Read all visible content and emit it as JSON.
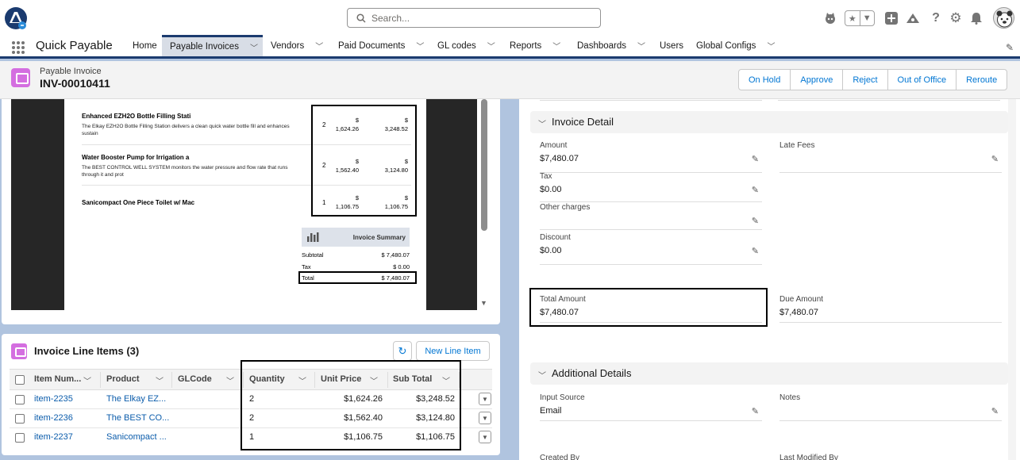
{
  "topbar": {
    "search_placeholder": "Search...",
    "icons": [
      "salesforce-logo",
      "agent-icon",
      "star-icon",
      "chevron-down-icon",
      "plus-icon",
      "trailhead-icon",
      "help-icon",
      "gear-icon",
      "bell-icon",
      "avatar"
    ]
  },
  "nav": {
    "app_name": "Quick Payable",
    "items": [
      {
        "label": "Home",
        "has_menu": false
      },
      {
        "label": "Payable Invoices",
        "has_menu": true,
        "active": true
      },
      {
        "label": "Vendors",
        "has_menu": true
      },
      {
        "label": "Paid Documents",
        "has_menu": true
      },
      {
        "label": "GL codes",
        "has_menu": true
      },
      {
        "label": "Reports",
        "has_menu": true
      },
      {
        "label": "Dashboards",
        "has_menu": true
      },
      {
        "label": "Users",
        "has_menu": false
      },
      {
        "label": "Global Configs",
        "has_menu": true
      }
    ]
  },
  "record": {
    "object_label": "Payable Invoice",
    "name": "INV-00010411",
    "actions": [
      "On Hold",
      "Approve",
      "Reject",
      "Out of Office",
      "Reroute"
    ]
  },
  "preview": {
    "items": [
      {
        "title": "Enhanced EZH2O Bottle Filling Stati",
        "desc": "The Elkay EZH2O Bottle Filling Station delivers a clean quick water bottle fill and enhances sustain",
        "qty": "2",
        "price_cur": "$",
        "price": "1,624.26",
        "total_cur": "$",
        "total": "3,248.52"
      },
      {
        "title": "Water Booster Pump for Irrigation a",
        "desc": "The BEST CONTROL WELL SYSTEM monitors the water pressure and flow rate that runs through it and prot",
        "qty": "2",
        "price_cur": "$",
        "price": "1,562.40",
        "total_cur": "$",
        "total": "3,124.80"
      },
      {
        "title": "Sanicompact One Piece Toilet w/ Mac",
        "desc": "",
        "qty": "1",
        "price_cur": "$",
        "price": "1,106.75",
        "total_cur": "$",
        "total": "1,106.75"
      }
    ],
    "summary": {
      "title": "Invoice Summary",
      "subtotal_label": "Subtotal",
      "subtotal": "$ 7,480.07",
      "tax_label": "Tax",
      "tax": "$ 0.00",
      "total_label": "Total",
      "total": "$ 7,480.07"
    }
  },
  "line_items": {
    "title": "Invoice Line Items (3)",
    "new_button": "New Line Item",
    "columns": [
      "Item Num...",
      "Product",
      "GLCode",
      "Quantity",
      "Unit Price",
      "Sub Total"
    ],
    "rows": [
      {
        "item": "item-2235",
        "product": "The Elkay EZ...",
        "glcode": "",
        "quantity": "2",
        "unit_price": "$1,624.26",
        "sub_total": "$3,248.52"
      },
      {
        "item": "item-2236",
        "product": "The BEST CO...",
        "glcode": "",
        "quantity": "2",
        "unit_price": "$1,562.40",
        "sub_total": "$3,124.80"
      },
      {
        "item": "item-2237",
        "product": "Sanicompact ...",
        "glcode": "",
        "quantity": "1",
        "unit_price": "$1,106.75",
        "sub_total": "$1,106.75"
      }
    ]
  },
  "detail": {
    "section_invoice": "Invoice Detail",
    "amount_label": "Amount",
    "amount": "$7,480.07",
    "late_fees_label": "Late Fees",
    "late_fees": "",
    "tax_label": "Tax",
    "tax": "$0.00",
    "other_label": "Other charges",
    "other": "",
    "discount_label": "Discount",
    "discount": "$0.00",
    "total_label": "Total Amount",
    "total": "$7,480.07",
    "due_label": "Due Amount",
    "due": "$7,480.07",
    "section_additional": "Additional Details",
    "input_source_label": "Input Source",
    "input_source": "Email",
    "notes_label": "Notes",
    "notes": "",
    "created_by_label": "Created By",
    "modified_by_label": "Last Modified By"
  }
}
